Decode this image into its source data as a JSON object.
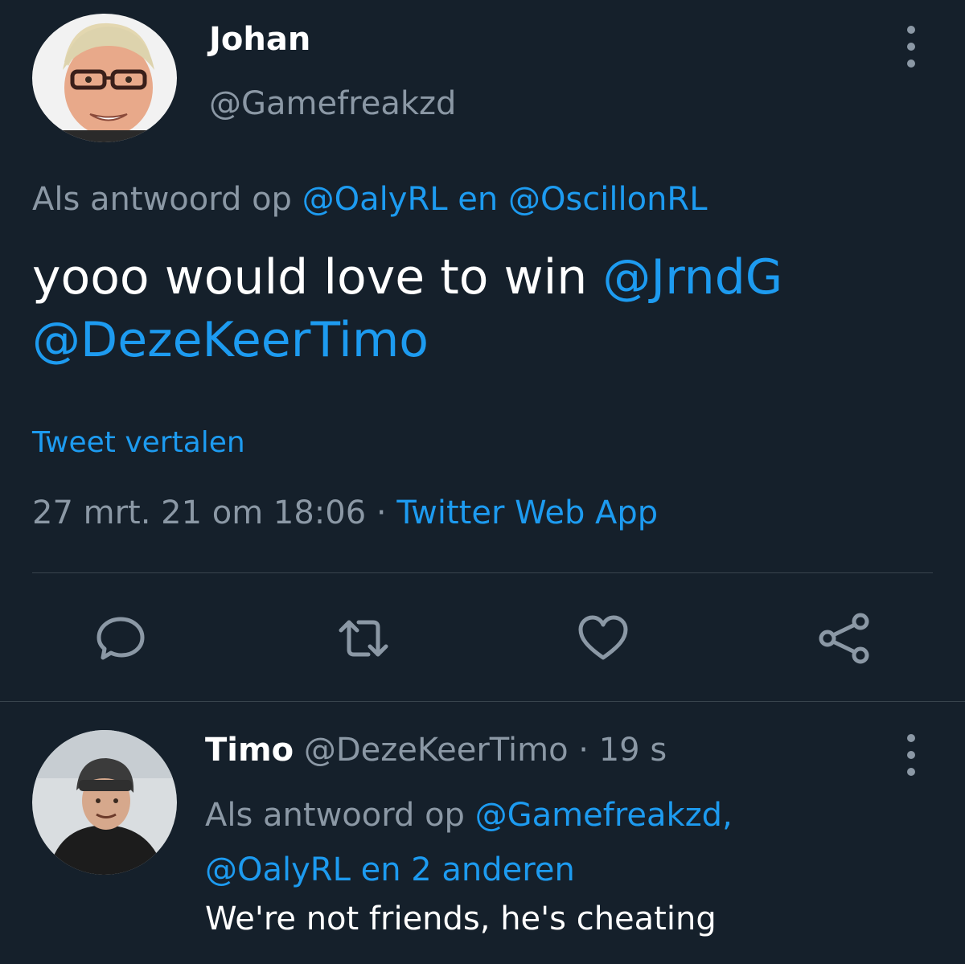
{
  "tweet": {
    "author_name": "Johan",
    "author_handle": "@Gamefreakzd",
    "reply_prefix": "Als antwoord op",
    "reply_mention_1": "@OalyRL",
    "reply_and": "en",
    "reply_mention_2": "@OscillonRL",
    "text": "yooo would love to win",
    "text_mention_1": "@JrndG",
    "text_mention_2": "@DezeKeerTimo",
    "translate_label": "Tweet vertalen",
    "timestamp": "27 mrt. 21 om 18:06",
    "separator": "·",
    "source": "Twitter Web App"
  },
  "actions": {
    "reply_icon": "reply-icon",
    "retweet_icon": "retweet-icon",
    "like_icon": "heart-icon",
    "share_icon": "share-icon"
  },
  "reply": {
    "author_name": "Timo",
    "author_handle": "@DezeKeerTimo",
    "separator": "·",
    "time": "19 s",
    "reply_prefix": "Als antwoord op",
    "reply_mention_1": "@Gamefreakzd,",
    "reply_mention_2": "@OalyRL",
    "reply_rest": "en 2 anderen",
    "text": "We're not friends, he's cheating"
  },
  "colors": {
    "background": "#15202b",
    "accent": "#1d9bf0",
    "muted": "#8b98a5",
    "divider": "#38444d"
  }
}
